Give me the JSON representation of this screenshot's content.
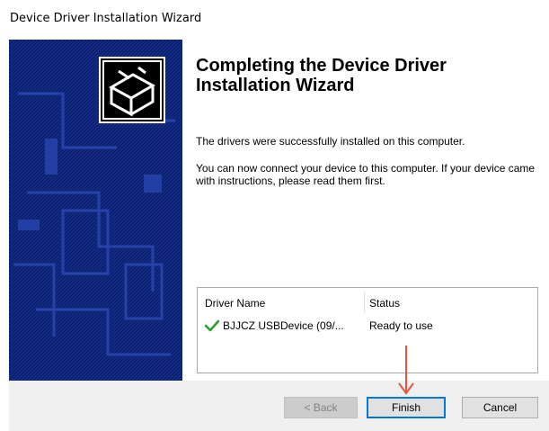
{
  "window": {
    "title": "Device Driver Installation Wizard"
  },
  "wizard": {
    "heading": "Completing the Device Driver Installation Wizard",
    "message_success": "The drivers were successfully installed on this computer.",
    "message_connect": "You can now connect your device to this computer. If your device came with instructions, please read them first."
  },
  "driver_list": {
    "columns": [
      "Driver Name",
      "Status"
    ],
    "rows": [
      {
        "name": "BJJCZ USBDevice  (09/...",
        "status": "Ready to use",
        "icon": "green-checkmark-icon"
      }
    ]
  },
  "buttons": {
    "back": "< Back",
    "finish": "Finish",
    "cancel": "Cancel"
  },
  "colors": {
    "side_panel": "#0a1f6e",
    "finish_border": "#0078d7",
    "check": "#2a9d2a",
    "annotation_arrow": "#e8553e"
  },
  "annotation": {
    "icon": "red-arrow-down-icon"
  }
}
